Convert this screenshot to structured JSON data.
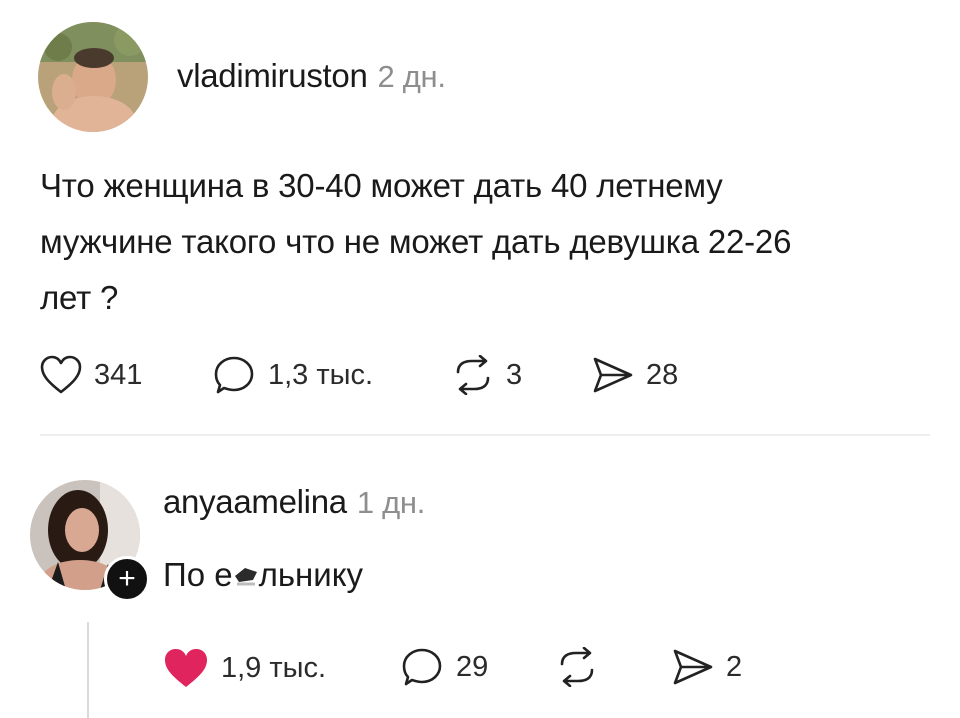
{
  "post": {
    "username": "vladimiruston",
    "age": "2 дн.",
    "text_lines": [
      "Что женщина в 30-40 может дать 40 летнему",
      "мужчине такого что не может дать девушка 22-26",
      "лет ?"
    ],
    "actions": {
      "likes": "341",
      "comments": "1,3 тыс.",
      "reposts": "3",
      "shares": "28"
    }
  },
  "reply": {
    "username": "anyaamelina",
    "age": "1 дн.",
    "text": "По е",
    "text_tail": "льнику",
    "actions": {
      "likes": "1,9 тыс.",
      "comments": "29",
      "reposts": "",
      "shares": "2"
    },
    "like_color": "#e0245e"
  },
  "icons": {
    "like": "heart-icon",
    "comment": "speech-bubble-icon",
    "repost": "repost-icon",
    "share": "send-icon",
    "follow": "plus-icon"
  }
}
